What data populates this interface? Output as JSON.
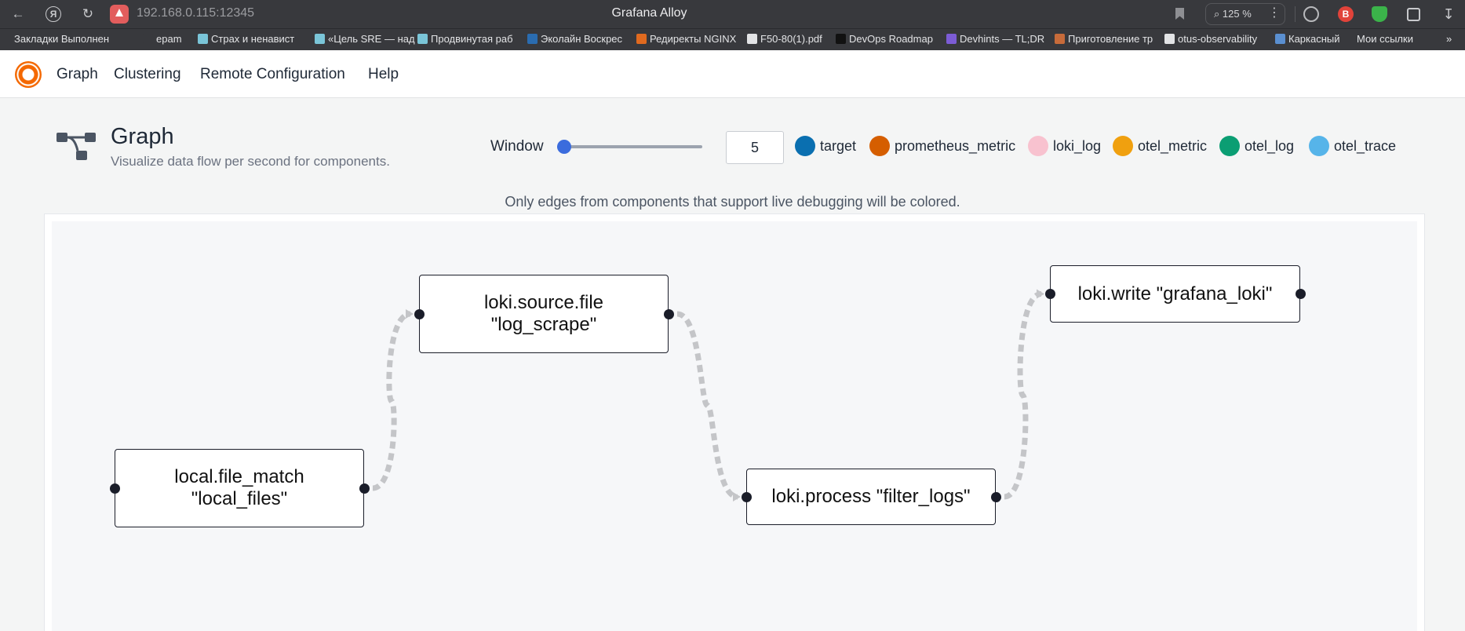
{
  "browser": {
    "url": "192.168.0.115:12345",
    "title": "Grafana Alloy",
    "zoom": "125 %",
    "bookmarks": [
      {
        "label": "Закладки Выполнен",
        "icon_color": "#38393d"
      },
      {
        "label": "epam",
        "icon_color": "#38393d"
      },
      {
        "label": "Страх и ненавист",
        "icon_color": "#7ac5d8"
      },
      {
        "label": "«Цель SRE — над",
        "icon_color": "#7ac5d8"
      },
      {
        "label": "Продвинутая раб",
        "icon_color": "#7ac5d8"
      },
      {
        "label": "Эколайн Воскрес",
        "icon_color": "#2a6cb0"
      },
      {
        "label": "Редиректы NGINX",
        "icon_color": "#e06a1f"
      },
      {
        "label": "F50-80(1).pdf",
        "icon_color": "#e3e4e6"
      },
      {
        "label": "DevOps Roadmap",
        "icon_color": "#111111"
      },
      {
        "label": "Devhints — TL;DR",
        "icon_color": "#7c5cd6"
      },
      {
        "label": "Приготовление тр",
        "icon_color": "#c76b3a"
      },
      {
        "label": "otus-observability",
        "icon_color": "#e3e4e6"
      },
      {
        "label": "Каркасный",
        "icon_color": "#5a8fd1"
      },
      {
        "label": "Мои ссылки",
        "icon_color": "#38393d"
      }
    ]
  },
  "nav": {
    "items": [
      {
        "label": "Graph"
      },
      {
        "label": "Clustering"
      },
      {
        "label": "Remote Configuration"
      },
      {
        "label": "Help"
      }
    ]
  },
  "header": {
    "title": "Graph",
    "subtitle": "Visualize data flow per second for components."
  },
  "window": {
    "label": "Window",
    "value": "5",
    "slider_fraction": 0.05
  },
  "legend": [
    {
      "label": "target",
      "color": "#0a6fb0"
    },
    {
      "label": "prometheus_metric",
      "color": "#d55e00"
    },
    {
      "label": "loki_log",
      "color": "#f8c2cf"
    },
    {
      "label": "otel_metric",
      "color": "#f0a00f"
    },
    {
      "label": "otel_log",
      "color": "#0b9e73"
    },
    {
      "label": "otel_trace",
      "color": "#56b4e9"
    }
  ],
  "note": "Only edges from components that support live debugging will be colored.",
  "graph": {
    "nodes": [
      {
        "id": "file_match",
        "label": "local.file_match\n\"local_files\""
      },
      {
        "id": "source_file",
        "label": "loki.source.file\n\"log_scrape\""
      },
      {
        "id": "process",
        "label": "loki.process \"filter_logs\""
      },
      {
        "id": "write",
        "label": "loki.write \"grafana_loki\""
      }
    ],
    "edges": [
      {
        "from": "file_match",
        "to": "source_file"
      },
      {
        "from": "source_file",
        "to": "process"
      },
      {
        "from": "process",
        "to": "write"
      }
    ],
    "edge_color": "#c4c5c8"
  }
}
